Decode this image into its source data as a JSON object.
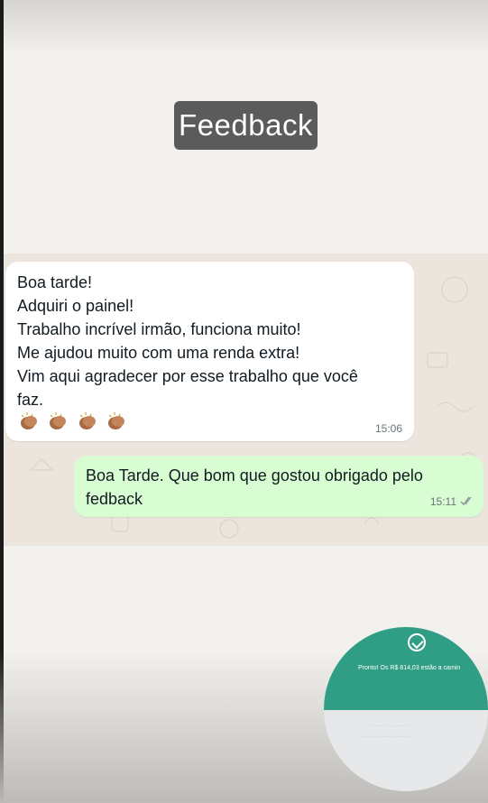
{
  "story_label": "Feedback",
  "chat": {
    "incoming": {
      "lines": [
        "Boa tarde!",
        "Adquiri o painel!",
        "Trabalho incrível irmão, funciona muito!",
        "Me ajudou muito com uma renda extra!",
        "Vim aqui agradecer por esse trabalho que você",
        "faz."
      ],
      "emoji": [
        "clapping-hands-icon",
        "clapping-hands-icon",
        "clapping-hands-icon",
        "clapping-hands-icon"
      ],
      "time": "15:06"
    },
    "outgoing": {
      "lines": [
        "Boa Tarde. Que bom que gostou obrigado pelo",
        "fedback"
      ],
      "time": "15:11",
      "status_icon": "double-check-icon"
    }
  },
  "overlay": {
    "icon": "check-circle-icon",
    "text": "Pronto! Os R$ 814,03 estão a camin"
  },
  "colors": {
    "chat_background": "#ebe5de",
    "incoming_bubble": "#ffffff",
    "outgoing_bubble": "#d9fdd3",
    "overlay_accent": "#2f9e85",
    "label_chip": "#5b5b5b"
  }
}
